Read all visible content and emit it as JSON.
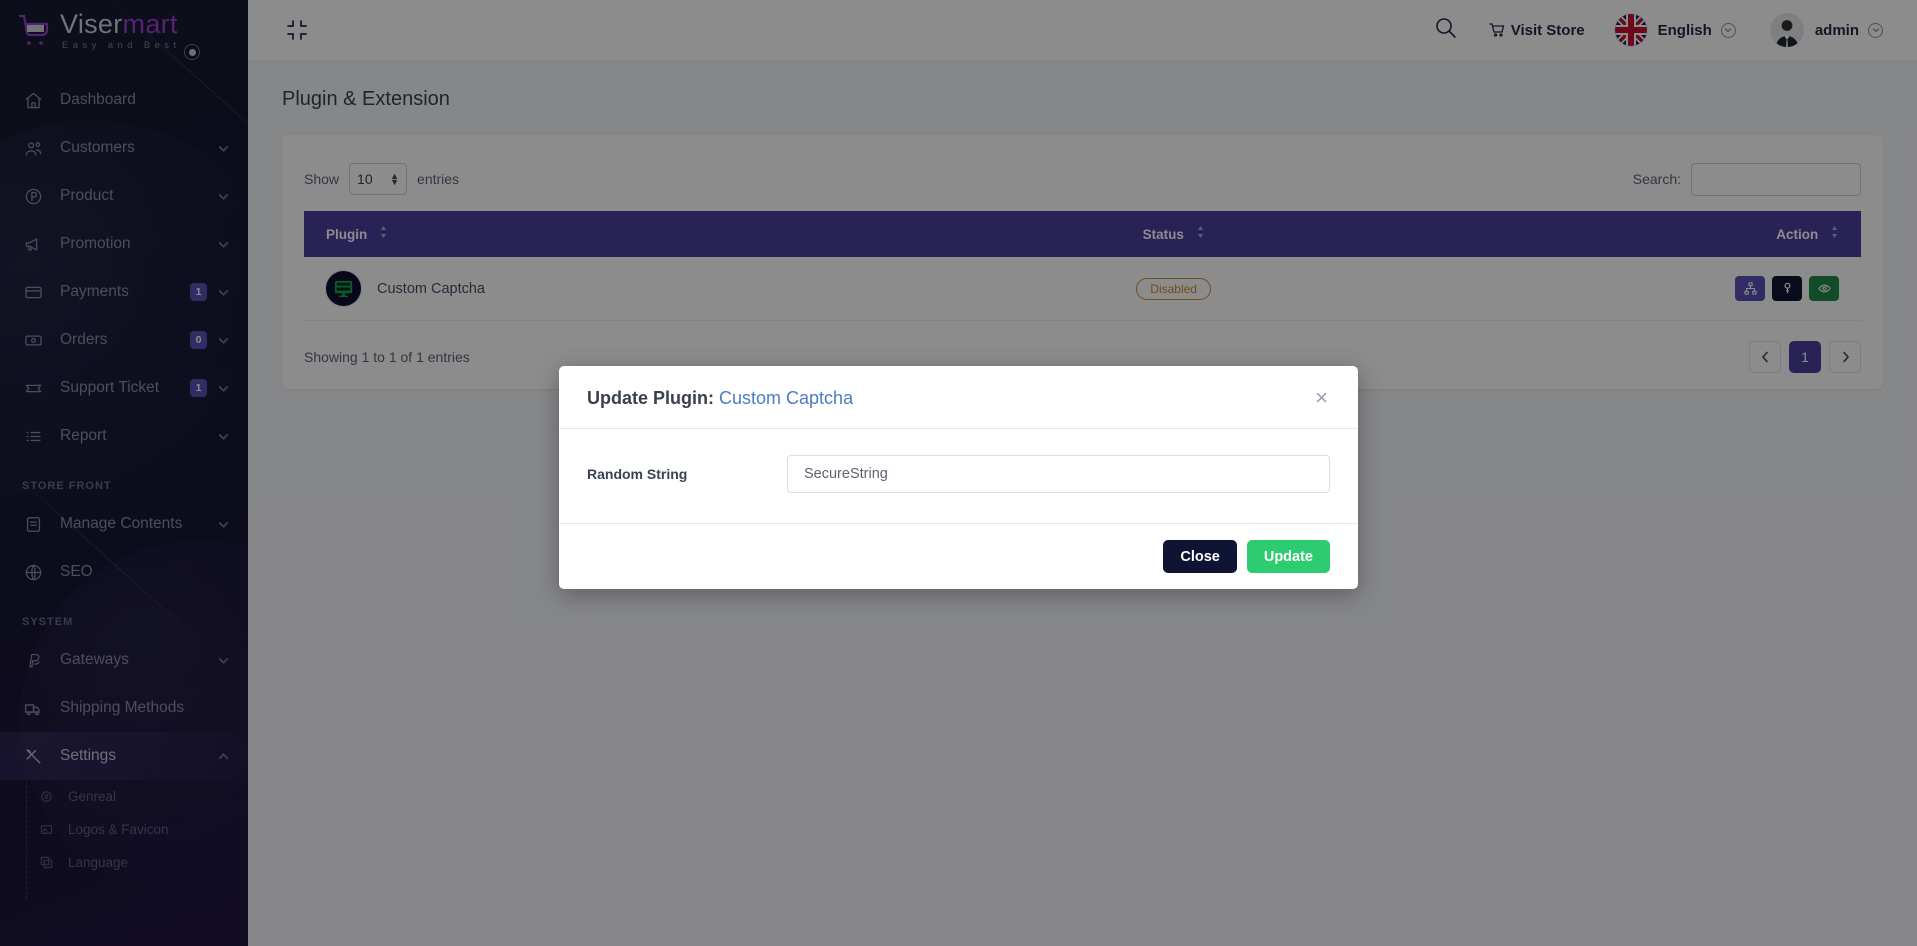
{
  "brand": {
    "name_part1": "Viser",
    "name_part2": "mart",
    "tagline": "Easy and Best"
  },
  "header": {
    "visit_store": "Visit Store",
    "language": "English",
    "user": "admin"
  },
  "sidebar": {
    "items": [
      {
        "label": "Dashboard",
        "icon": "home-icon",
        "badge": null,
        "caret": false
      },
      {
        "label": "Customers",
        "icon": "users-icon",
        "badge": null,
        "caret": true
      },
      {
        "label": "Product",
        "icon": "product-icon",
        "badge": null,
        "caret": true
      },
      {
        "label": "Promotion",
        "icon": "megaphone-icon",
        "badge": null,
        "caret": true
      },
      {
        "label": "Payments",
        "icon": "credit-card-icon",
        "badge": "1",
        "caret": true
      },
      {
        "label": "Orders",
        "icon": "money-icon",
        "badge": "0",
        "caret": true
      },
      {
        "label": "Support Ticket",
        "icon": "ticket-icon",
        "badge": "1",
        "caret": true
      },
      {
        "label": "Report",
        "icon": "list-icon",
        "badge": null,
        "caret": true
      }
    ],
    "section_store_front": "STORE FRONT",
    "store_front_items": [
      {
        "label": "Manage Contents",
        "icon": "contents-icon",
        "caret": true
      },
      {
        "label": "SEO",
        "icon": "globe-icon",
        "caret": false
      }
    ],
    "section_system": "SYSTEM",
    "system_items": [
      {
        "label": "Gateways",
        "icon": "paypal-icon",
        "caret": true
      },
      {
        "label": "Shipping Methods",
        "icon": "truck-icon",
        "caret": false
      }
    ],
    "settings": {
      "label": "Settings",
      "icon": "tools-icon"
    },
    "settings_submenu": [
      {
        "label": "Genreal",
        "icon": "gear-icon"
      },
      {
        "label": "Logos & Favicon",
        "icon": "image-icon"
      },
      {
        "label": "Language",
        "icon": "language-icon"
      }
    ]
  },
  "main": {
    "page_title": "Plugin & Extension",
    "show_label": "Show",
    "entries_label": "entries",
    "page_length": "10",
    "search_label": "Search:",
    "search_value": "",
    "columns": [
      "Plugin",
      "Status",
      "Action"
    ],
    "rows": [
      {
        "plugin": "Custom Captcha",
        "status": "Disabled",
        "actions": [
          "sitemap-icon",
          "key-icon",
          "eye-icon"
        ]
      }
    ],
    "info": "Showing 1 to 1 of 1 entries",
    "pagination": {
      "prev": "‹",
      "pages": [
        "1"
      ],
      "next": "›",
      "current": "1"
    }
  },
  "modal": {
    "title_main": "Update Plugin:",
    "title_sub": "Custom Captcha",
    "close_x": "×",
    "field_label": "Random String",
    "field_value": "SecureString",
    "field_placeholder": "Random String",
    "close_button": "Close",
    "update_button": "Update"
  },
  "colors": {
    "accent_purple": "#4a3f9e",
    "badge_purple": "#5b50b7",
    "green": "#2ecc71",
    "dark_navy": "#101434",
    "disabled_orange": "#d08a3a"
  }
}
